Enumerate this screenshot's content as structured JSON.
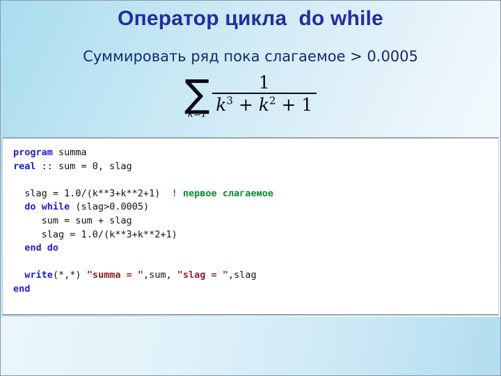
{
  "slide": {
    "title": "Оператор цикла  do while",
    "subtitle": "Суммировать ряд пока слагаемое > 0.0005",
    "colors": {
      "title": "#232d9e",
      "subtitle": "#152a6b",
      "keyword": "#1d1dcf",
      "comment": "#0b8a32",
      "string": "#8c1f28",
      "code_text": "#111111",
      "panel_background": "#ffffff",
      "panel_border": "#9aa3ad",
      "slide_background_left": "#a9dcee",
      "slide_background_right": "#f7fbfd"
    }
  },
  "formula": {
    "sigma": "∑",
    "lower_limit": "k=1",
    "numerator": "1",
    "denominator_base1": "k",
    "denominator_exp1": "3",
    "denominator_plus1": " + ",
    "denominator_base2": "k",
    "denominator_exp2": "2",
    "denominator_plus2": " + ",
    "denominator_const": "1",
    "plain_text": "∑(k=1) 1/(k^3 + k^2 + 1)"
  },
  "code": {
    "language": "Fortran",
    "lines": [
      {
        "id": "l1",
        "segments": [
          {
            "t": "program",
            "c": "kw"
          },
          {
            "t": " summa",
            "c": ""
          }
        ]
      },
      {
        "id": "l2",
        "segments": [
          {
            "t": "real",
            "c": "kw"
          },
          {
            "t": " :: sum = 0, slag",
            "c": ""
          }
        ]
      },
      {
        "id": "l3",
        "segments": []
      },
      {
        "id": "l4",
        "segments": [
          {
            "t": "  slag = 1.0/(k**3+k**2+1)  ",
            "c": ""
          },
          {
            "t": "! первое слагаемое",
            "c": "cm"
          }
        ]
      },
      {
        "id": "l5",
        "segments": [
          {
            "t": "  ",
            "c": ""
          },
          {
            "t": "do while",
            "c": "kw"
          },
          {
            "t": " (slag>0.0005)",
            "c": ""
          }
        ]
      },
      {
        "id": "l6",
        "segments": [
          {
            "t": "     sum = sum + slag",
            "c": ""
          }
        ]
      },
      {
        "id": "l7",
        "segments": [
          {
            "t": "     slag = 1.0/(k**3+k**2+1)",
            "c": ""
          }
        ]
      },
      {
        "id": "l8",
        "segments": [
          {
            "t": "  ",
            "c": ""
          },
          {
            "t": "end do",
            "c": "kw"
          }
        ]
      },
      {
        "id": "l9",
        "segments": []
      },
      {
        "id": "l10",
        "segments": [
          {
            "t": "  ",
            "c": ""
          },
          {
            "t": "write",
            "c": "kw"
          },
          {
            "t": "(*,*) ",
            "c": ""
          },
          {
            "t": "\"summa = \"",
            "c": "st"
          },
          {
            "t": ",sum, ",
            "c": ""
          },
          {
            "t": "\"slag = \"",
            "c": "st"
          },
          {
            "t": ",slag",
            "c": ""
          }
        ]
      },
      {
        "id": "l11",
        "segments": [
          {
            "t": "end",
            "c": "kw"
          }
        ]
      }
    ]
  }
}
